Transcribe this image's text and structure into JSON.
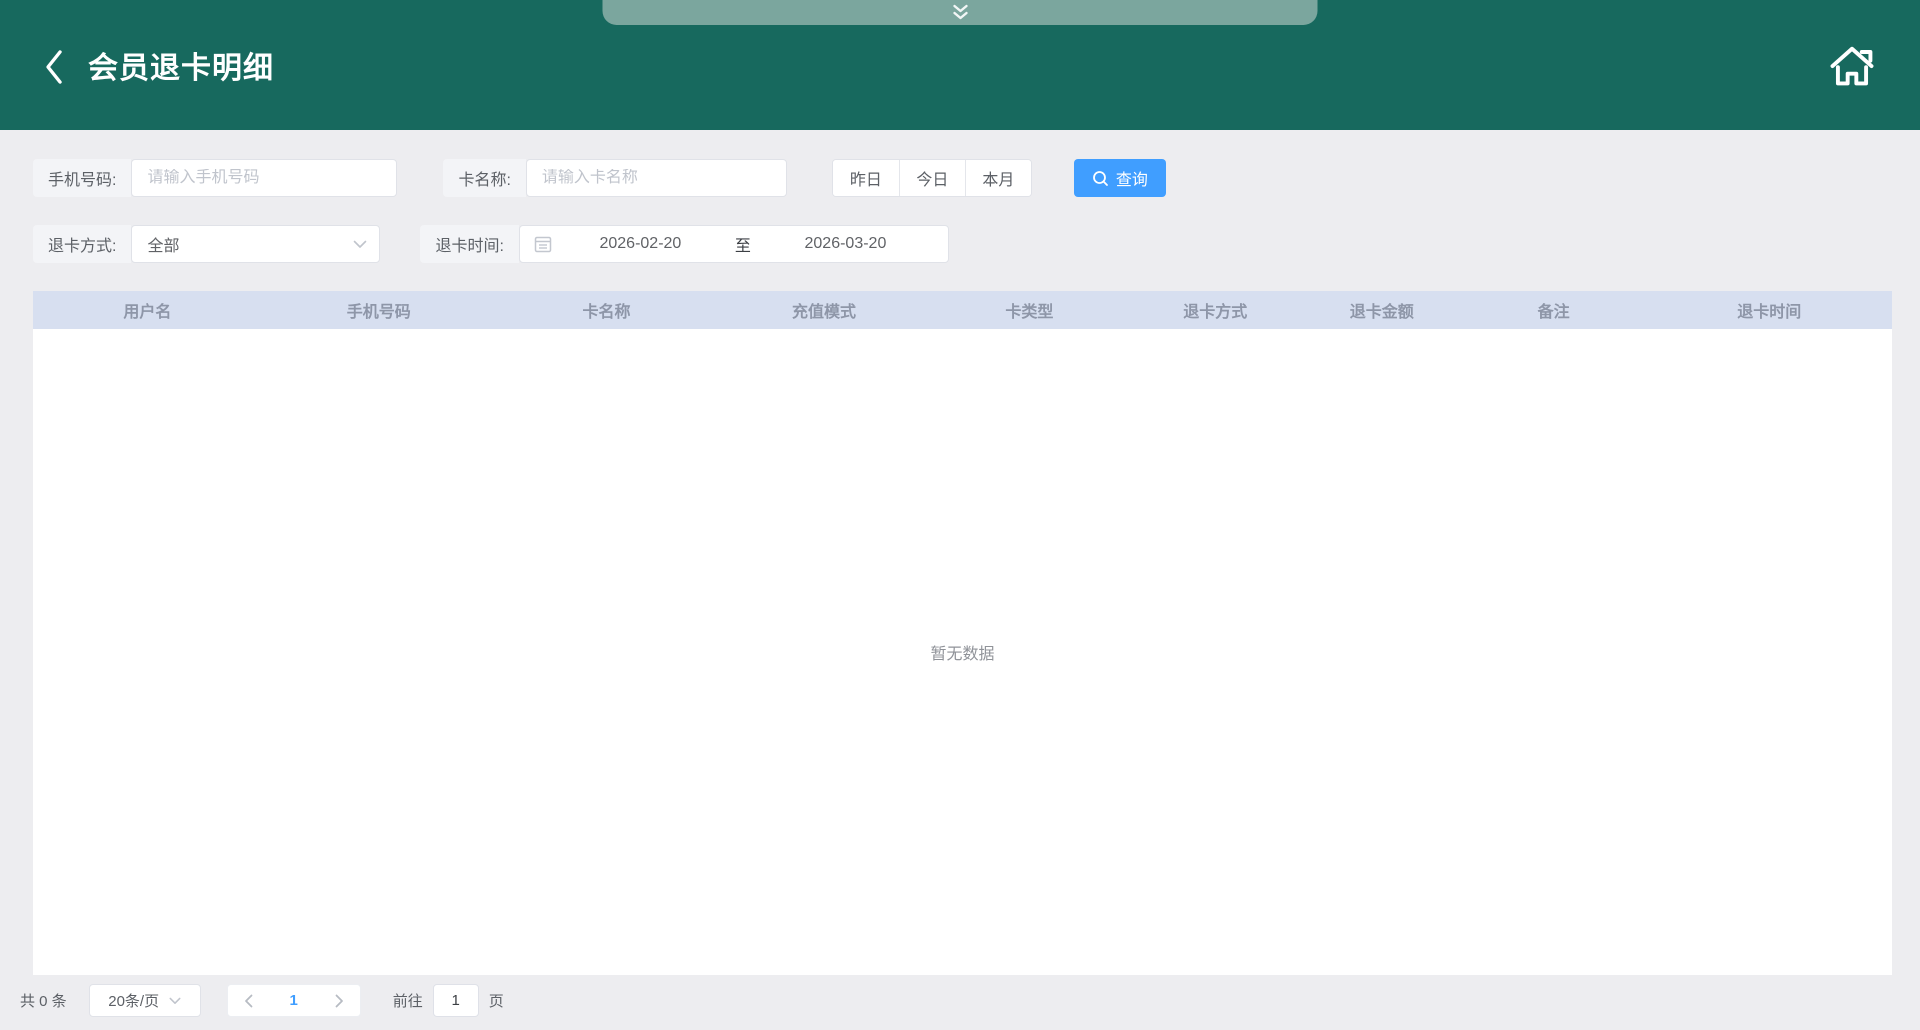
{
  "header": {
    "title": "会员退卡明细"
  },
  "filters": {
    "phone": {
      "label": "手机号码:",
      "placeholder": "请输入手机号码",
      "value": ""
    },
    "card_name": {
      "label": "卡名称:",
      "placeholder": "请输入卡名称",
      "value": ""
    },
    "quick_buttons": {
      "yesterday": "昨日",
      "today": "今日",
      "this_month": "本月"
    },
    "search_button": "查询",
    "refund_method": {
      "label": "退卡方式:",
      "value": "全部"
    },
    "refund_time": {
      "label": "退卡时间:",
      "start": "2026-02-20",
      "separator": "至",
      "end": "2026-03-20"
    }
  },
  "table": {
    "columns": [
      "用户名",
      "手机号码",
      "卡名称",
      "充值模式",
      "卡类型",
      "退卡方式",
      "退卡金额",
      "备注",
      "退卡时间"
    ],
    "empty_text": "暂无数据",
    "rows": []
  },
  "pagination": {
    "total_text": "共 0 条",
    "page_size": "20条/页",
    "current_page": "1",
    "goto_label": "前往",
    "goto_value": "1",
    "goto_suffix": "页"
  },
  "colors": {
    "header_background": "#17695e",
    "handle_background": "#7ba69e",
    "accent_blue": "#409eff",
    "table_header_background": "#d7dff0",
    "page_background": "#ededf0"
  }
}
